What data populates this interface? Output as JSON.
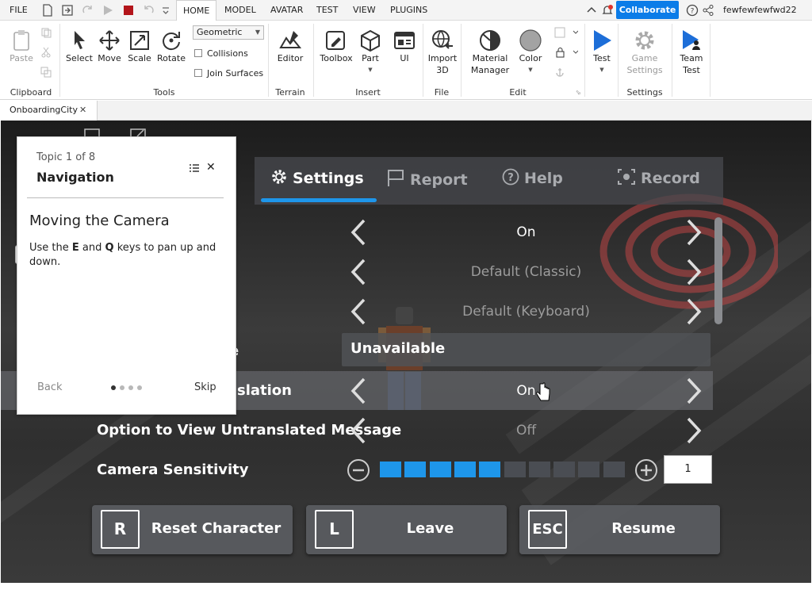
{
  "menubar": {
    "file": "FILE",
    "tabs": [
      "HOME",
      "MODEL",
      "AVATAR",
      "TEST",
      "VIEW",
      "PLUGINS"
    ],
    "collaborate": "Collaborate",
    "username": "fewfewfewfwd22"
  },
  "ribbon": {
    "clipboard": {
      "paste": "Paste",
      "group": "Clipboard"
    },
    "tools": {
      "select": "Select",
      "move": "Move",
      "scale": "Scale",
      "rotate": "Rotate",
      "geometry": "Geometric",
      "collisions": "Collisions",
      "join": "Join Surfaces",
      "group": "Tools"
    },
    "terrain": {
      "editor": "Editor",
      "group": "Terrain"
    },
    "insert": {
      "toolbox": "Toolbox",
      "part": "Part",
      "ui": "UI",
      "group": "Insert"
    },
    "file": {
      "import_line1": "Import",
      "import_line2": "3D",
      "group": "File"
    },
    "edit": {
      "material_line1": "Material",
      "material_line2": "Manager",
      "color": "Color",
      "group": "Edit"
    },
    "test": {
      "test": "Test"
    },
    "settings": {
      "game_line1": "Game",
      "game_line2": "Settings",
      "group": "Settings"
    },
    "teamtest": {
      "line1": "Team",
      "line2": "Test"
    }
  },
  "doc_tab": {
    "name": "OnboardingCity",
    "close": "✕"
  },
  "settings_menu": {
    "tabs": [
      "Settings",
      "Report",
      "Help",
      "Record"
    ],
    "rows": [
      {
        "label": "",
        "value": "On"
      },
      {
        "label": "",
        "value": "Default (Classic)"
      },
      {
        "label": "",
        "value": "Default (Keyboard)"
      },
      {
        "label": "e",
        "value": ""
      },
      {
        "label": "slation",
        "value": "On"
      },
      {
        "label": "Option to View Untranslated Message",
        "value": "Off"
      }
    ],
    "unavailable": "Unavailable",
    "camera_sensitivity": {
      "label": "Camera Sensitivity",
      "value": "1",
      "level": 5,
      "max": 10
    },
    "buttons": [
      {
        "key": "R",
        "label": "Reset Character"
      },
      {
        "key": "L",
        "label": "Leave"
      },
      {
        "key": "ESC",
        "label": "Resume"
      }
    ],
    "accent": "#1e96ea"
  },
  "tutorial": {
    "topic": "Topic 1 of 8",
    "title": "Navigation",
    "heading": "Moving the Camera",
    "body_pre": "Use the ",
    "key1": "E",
    "body_mid": " and ",
    "key2": "Q",
    "body_post": " keys to pan up and down.",
    "back": "Back",
    "skip": "Skip",
    "page_index": 1,
    "page_count": 4
  }
}
